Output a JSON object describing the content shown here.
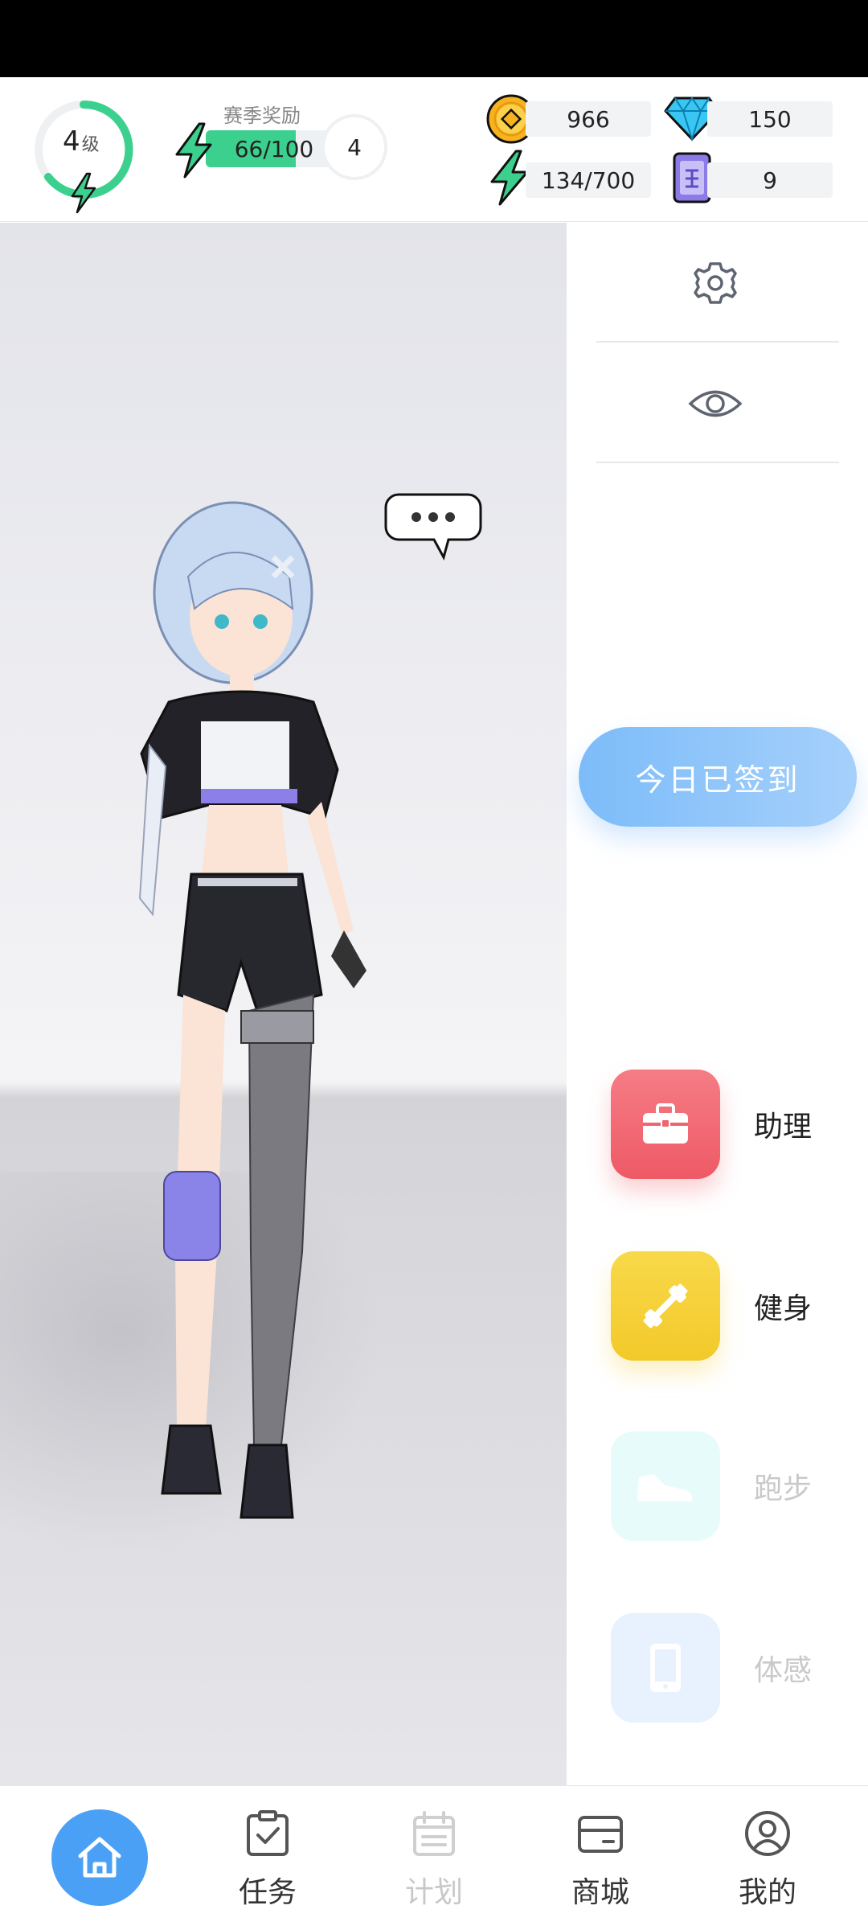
{
  "header": {
    "level_value": "4",
    "level_unit": "级",
    "season_label": "赛季奖励",
    "season_progress_text": "66/100",
    "season_progress_fraction": 0.66,
    "season_badge": "4",
    "coins": "966",
    "diamonds": "150",
    "energy": "134/700",
    "tickets": "9"
  },
  "right_panel": {
    "signin_label": "今日已签到",
    "menu": [
      {
        "label": "助理",
        "icon": "briefcase-icon",
        "enabled": true
      },
      {
        "label": "健身",
        "icon": "dumbbell-icon",
        "enabled": true
      },
      {
        "label": "跑步",
        "icon": "sneaker-icon",
        "enabled": false
      },
      {
        "label": "体感",
        "icon": "phone-icon",
        "enabled": false
      }
    ]
  },
  "nav": {
    "home_icon": "home-icon",
    "tasks": "任务",
    "plan": "计划",
    "shop": "商城",
    "mine": "我的"
  },
  "colors": {
    "accent_green": "#3bd08e",
    "home_blue": "#4aa0f5",
    "signin_blue": "#7cbcf9",
    "assist_red": "#ee5a66",
    "fitness_yellow": "#f3c92a"
  }
}
